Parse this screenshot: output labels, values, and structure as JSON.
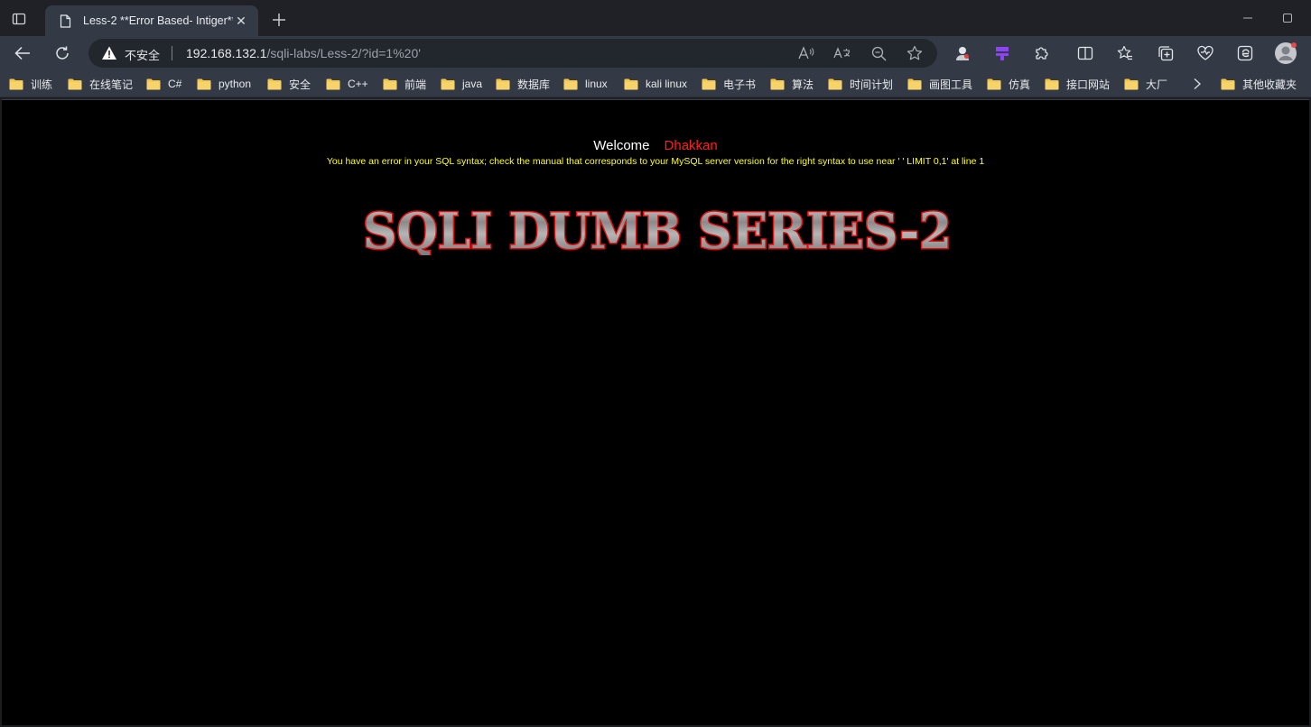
{
  "browser": {
    "tab": {
      "title": "Less-2 **Error Based- Intiger**",
      "close": "✕"
    },
    "new_tab": "+",
    "address": {
      "security_label": "不安全",
      "url_host": "192.168.132.1",
      "url_path": "/sqli-labs/Less-2/?id=1%20'"
    },
    "omnibox_icons": [
      "read-aloud-icon",
      "translate-icon",
      "zoom-icon",
      "favorite-star-icon"
    ],
    "toolbar_icons": [
      "extension-avatar-icon",
      "extension-purple-icon",
      "extensions-icon",
      "split-screen-icon",
      "favorites-icon",
      "collections-icon",
      "performance-icon",
      "edge-copilot-icon",
      "profile-icon"
    ],
    "bookmarks": [
      "训练",
      "在线笔记",
      "C#",
      "python",
      "安全",
      "C++",
      "前端",
      "java",
      "数据库",
      "linux",
      "kali linux",
      "电子书",
      "算法",
      "时间计划",
      "画图工具",
      "仿真",
      "接口网站",
      "大厂"
    ],
    "other_bookmarks": "其他收藏夹",
    "colors": {
      "tab_bg": "#343a45",
      "folder": "#f4c74a",
      "warning": "#ffffff"
    }
  },
  "page": {
    "welcome": "Welcome",
    "name": "Dhakkan",
    "error": "You have an error in your SQL syntax; check the manual that corresponds to your MySQL server version for the right syntax to use near '  ' LIMIT 0,1' at line 1",
    "banner": "SQLI DUMB SERIES-2",
    "colors": {
      "background": "#000000",
      "name": "#ff1e1e",
      "error": "#ffff22"
    }
  }
}
